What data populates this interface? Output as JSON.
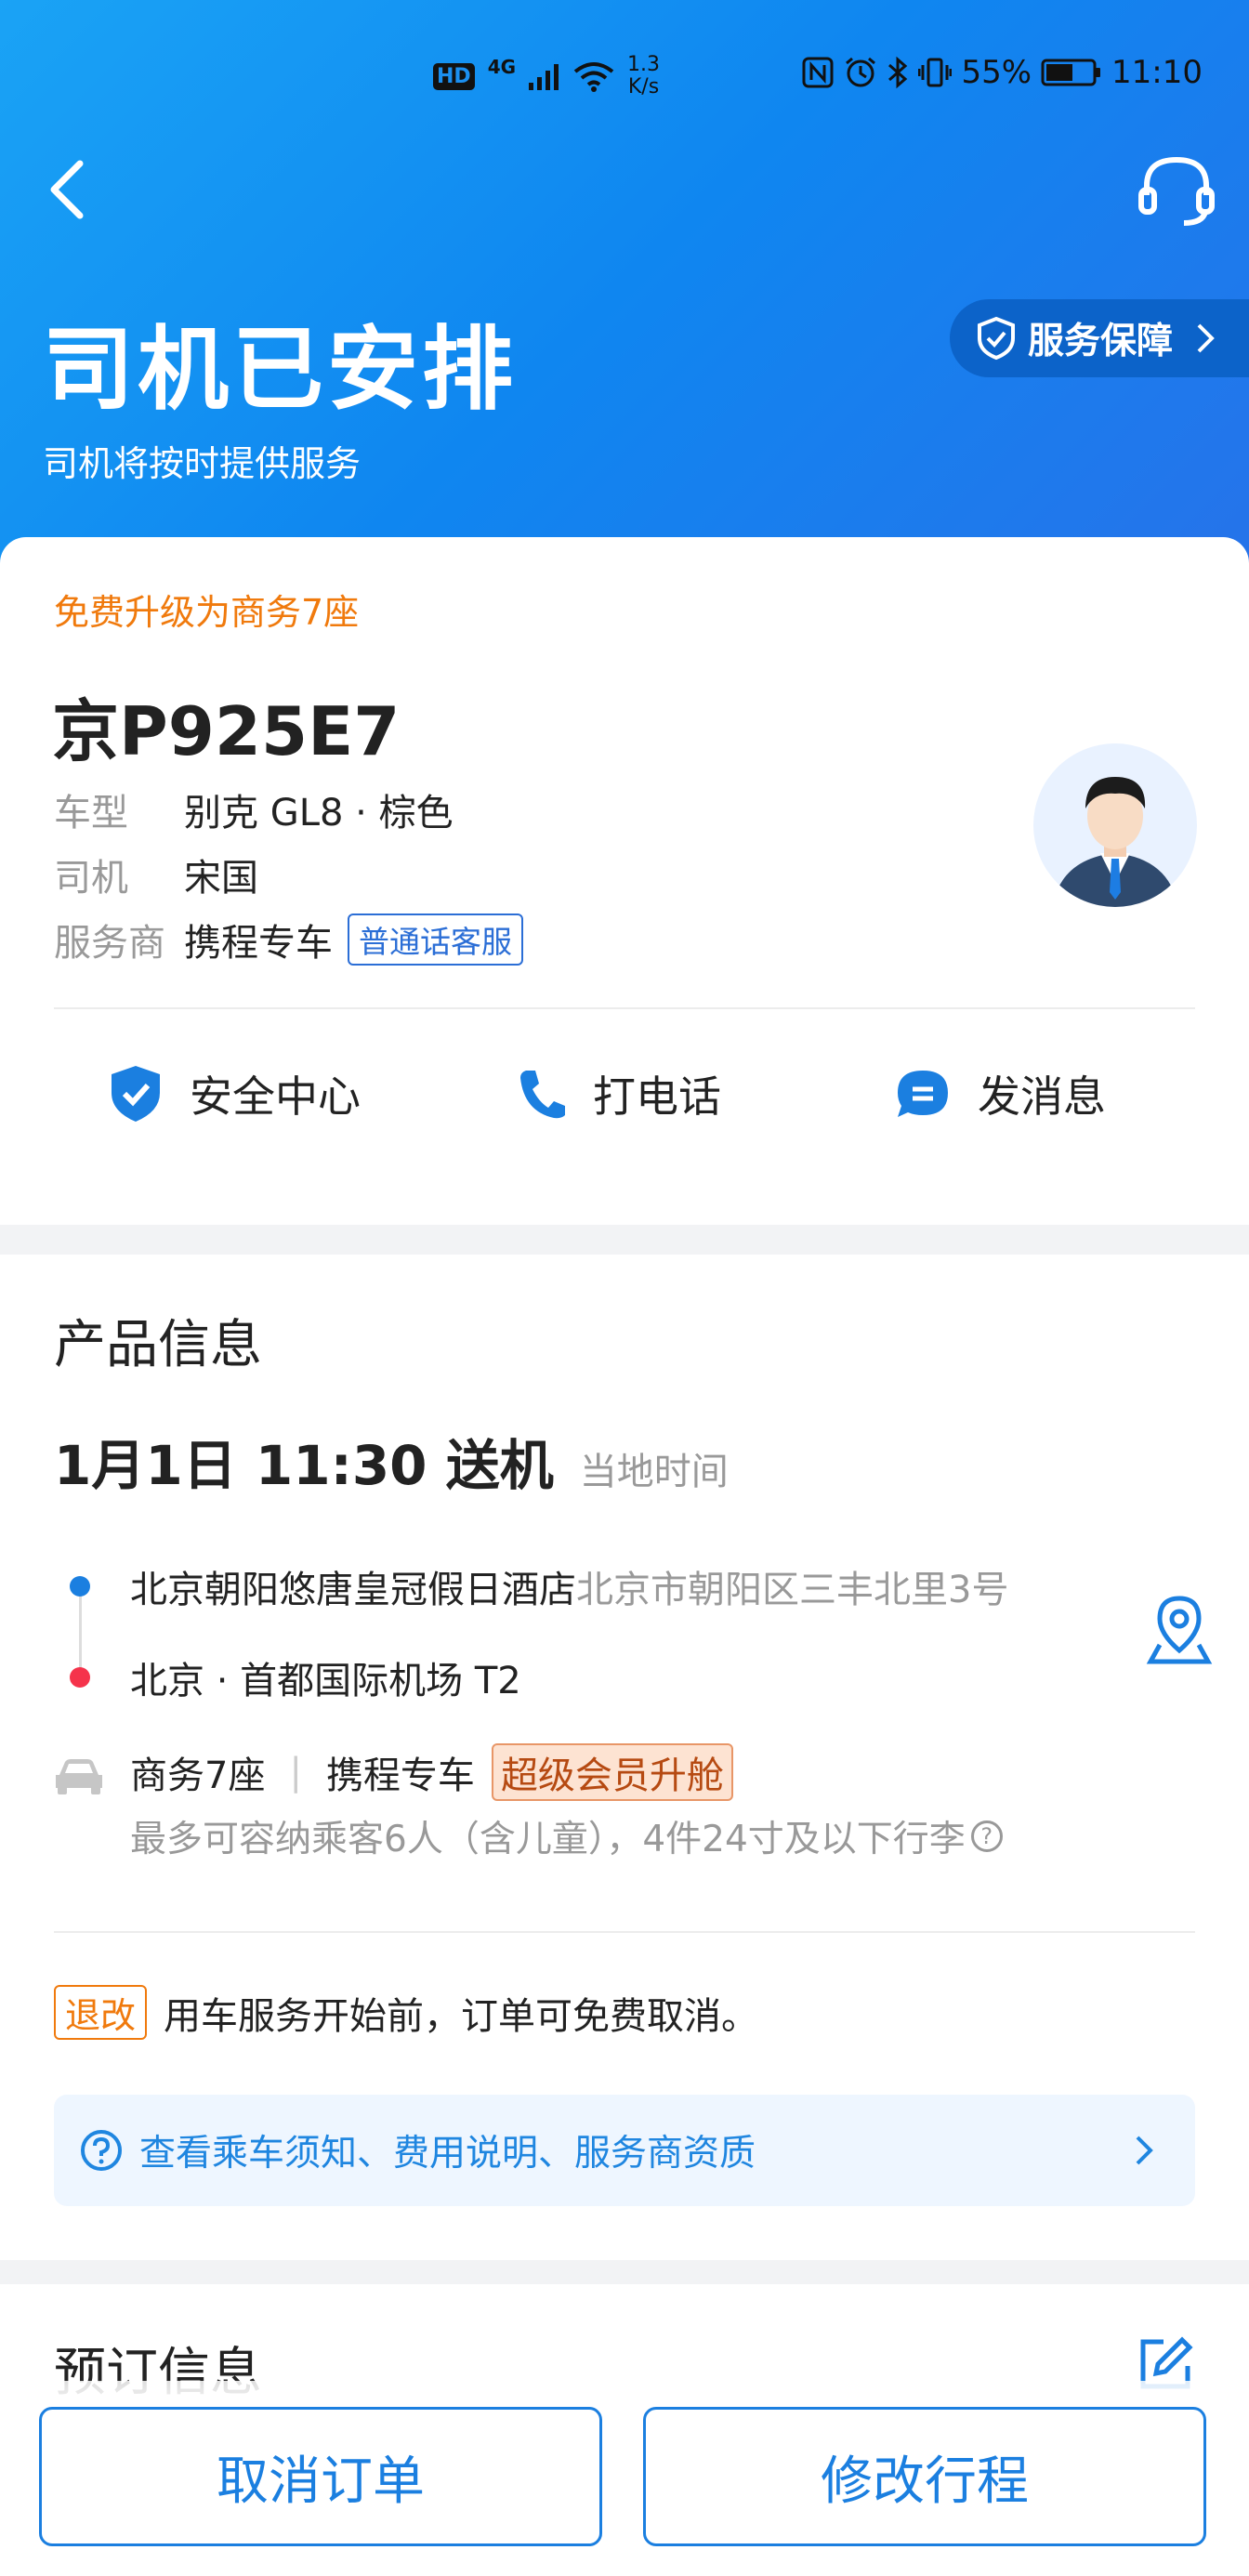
{
  "status_bar": {
    "network_hd": "HD",
    "network_type": "4G",
    "speed_value": "1.3",
    "speed_unit": "K/s",
    "battery": "55%",
    "time": "11:10"
  },
  "header": {
    "title": "司机已安排",
    "subtitle": "司机将按时提供服务",
    "service_guarantee": "服务保障",
    "background_color": "#1a8ef2"
  },
  "driver_card": {
    "upgrade_notice": "免费升级为商务7座",
    "plate": "京P925E7",
    "car_model_label": "车型",
    "car_model_value": "别克 GL8 · 棕色",
    "driver_label": "司机",
    "driver_value": "宋国",
    "provider_label": "服务商",
    "provider_value": "携程专车",
    "provider_tag": "普通话客服",
    "actions": [
      {
        "label": "安全中心",
        "icon": "shield-check-icon"
      },
      {
        "label": "打电话",
        "icon": "phone-icon"
      },
      {
        "label": "发消息",
        "icon": "message-icon"
      }
    ]
  },
  "product_info": {
    "title": "产品信息",
    "trip_time": "1月1日 11:30 送机",
    "local_time_label": "当地时间",
    "origin_name": "北京朝阳悠唐皇冠假日酒店",
    "origin_address": "北京市朝阳区三丰北里3号",
    "destination": "北京 · 首都国际机场 T2",
    "car_class": "商务7座",
    "car_provider": "携程专车",
    "vip_tag": "超级会员升舱",
    "capacity": "最多可容纳乘客6人（含儿童），4件24寸及以下行李",
    "cancel_tag": "退改",
    "cancel_text": "用车服务开始前，订单可免费取消。",
    "notice_link": "查看乘车须知、费用说明、服务商资质"
  },
  "booking_info": {
    "title": "预订信息"
  },
  "bottom_actions": {
    "cancel_order": "取消订单",
    "modify_trip": "修改行程"
  }
}
